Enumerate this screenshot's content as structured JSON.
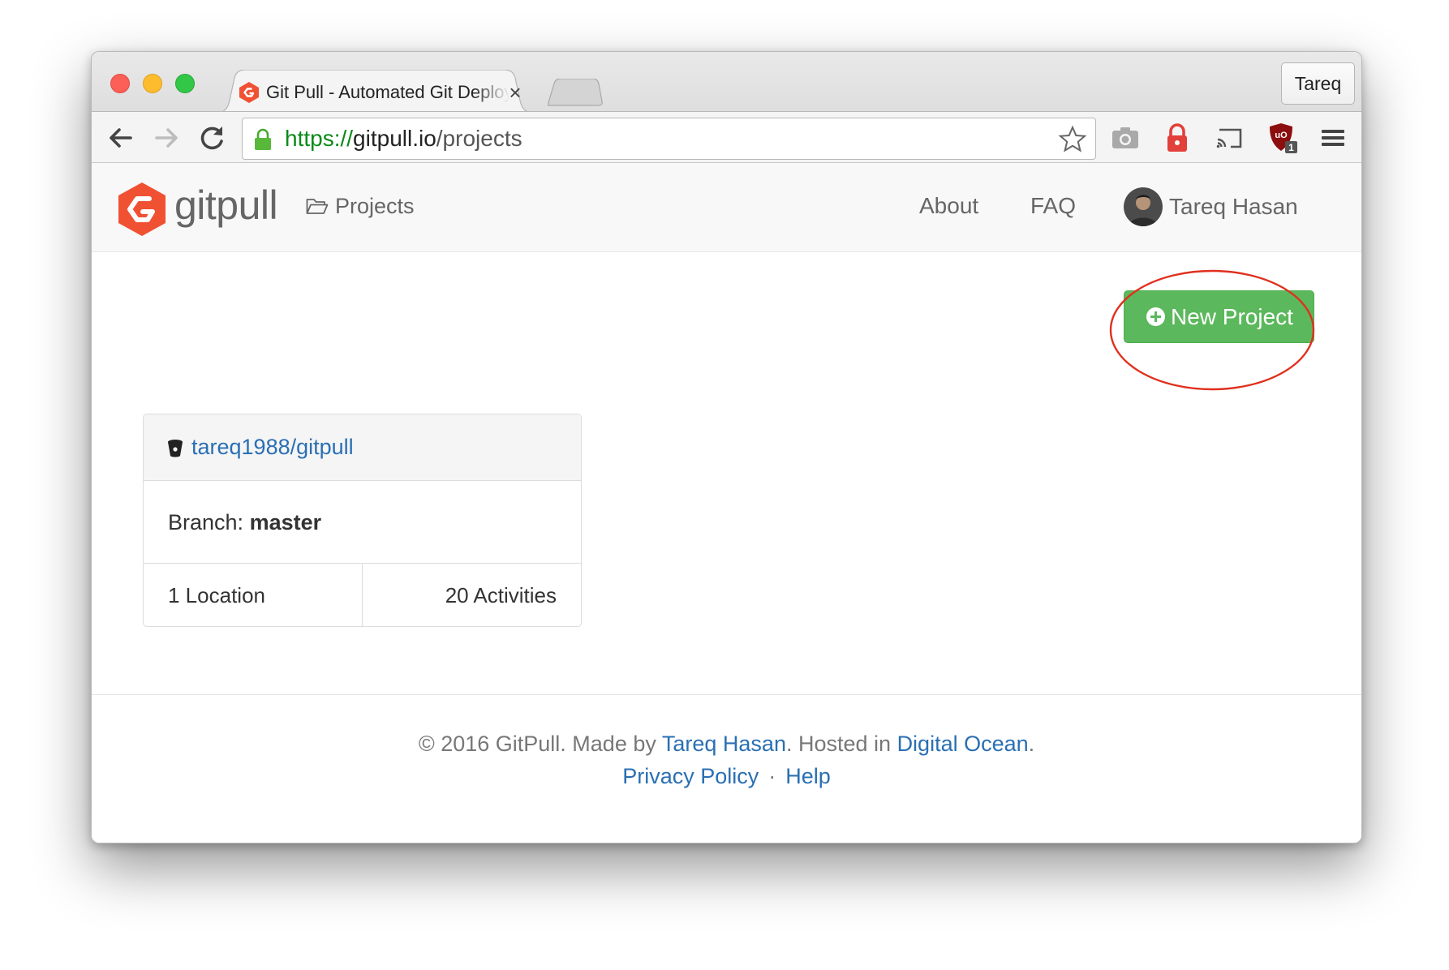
{
  "browser": {
    "tab_title": "Git Pull - Automated Git Deployment",
    "tab_close": "×",
    "profile_name": "Tareq",
    "url": {
      "scheme": "https://",
      "host": "gitpull.io",
      "path": "/projects"
    },
    "toolbar_icons": [
      "back-arrow-icon",
      "forward-arrow-icon",
      "reload-icon",
      "star-icon",
      "camera-icon",
      "lock-extension-icon",
      "cast-icon",
      "ublock-icon",
      "menu-icon"
    ],
    "ublock_badge": "1"
  },
  "navbar": {
    "brand": "gitpull",
    "projects_label": "Projects",
    "about_label": "About",
    "faq_label": "FAQ",
    "user_name": "Tareq Hasan"
  },
  "main": {
    "new_project_label": "New Project",
    "project": {
      "repo": "tareq1988/gitpull",
      "branch_label": "Branch:",
      "branch_value": "master",
      "locations": "1 Location",
      "activities": "20 Activities"
    }
  },
  "footer": {
    "copyright": "© 2016 GitPull. Made by",
    "author": "Tareq Hasan",
    "hosted_text": ". Hosted in",
    "host": "Digital Ocean",
    "period": ".",
    "privacy": "Privacy Policy",
    "separator": "·",
    "help": "Help"
  },
  "colors": {
    "brand_orange": "#f05133",
    "success_green": "#5cb85c",
    "link_blue": "#2a6fb3",
    "annotation_red": "#e0301e",
    "url_green": "#0a8a18"
  }
}
